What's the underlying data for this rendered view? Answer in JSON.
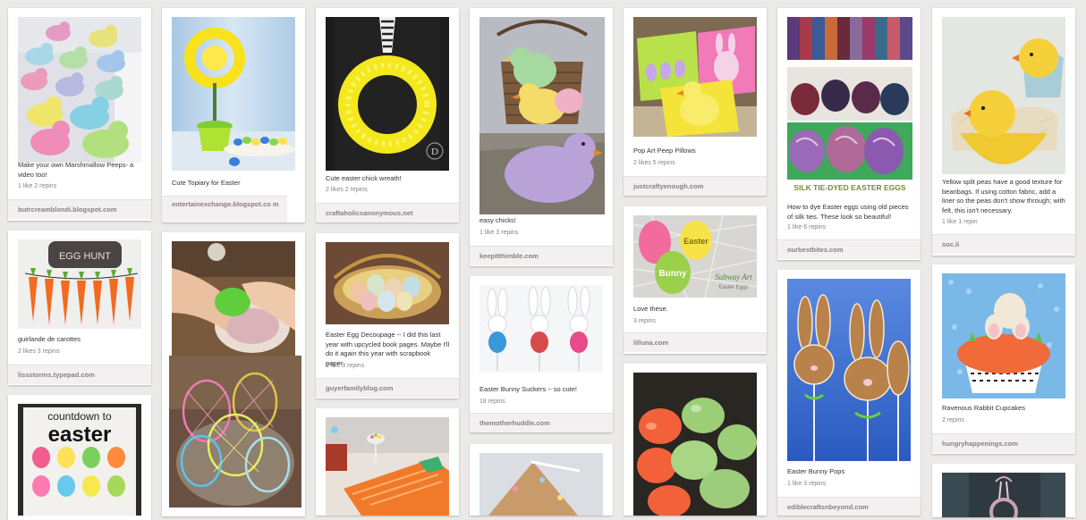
{
  "pins": {
    "peeps": {
      "description": "Make your own Marshmallow Peeps- a video too!",
      "stats": "1 like  2 repins",
      "source": "butrcreamblondi.blogspot.com"
    },
    "carrots": {
      "image_text": "EGG HUNT",
      "description": "guirlande de carottes",
      "stats": "2 likes  3 repins",
      "source": "lissstorms.typepad.com"
    },
    "countdown": {
      "image_text_line1": "countdown to",
      "image_text_line2": "easter"
    },
    "topiary": {
      "description": "Cute Topiary for Easter",
      "source": "entertainexchange.blogspot.co m"
    },
    "egg_dye": {},
    "string_eggs": {},
    "wreath": {
      "description": "Cute easter chick wreath!",
      "stats": "2 likes  2 repins",
      "source": "craftaholicsanonymous.net"
    },
    "decoupage": {
      "description": "Easter Egg Decoupage -- I did this last year with upcycled book pages. Maybe I'll do it again this year with scrapbook paper.",
      "stats": "1 like  3 repins",
      "source": "guyerfamilyblog.com"
    },
    "table_runner": {},
    "chicks": {
      "description": "easy chicks!",
      "stats": "1 like  3 repins",
      "source": "keepitthimble.com"
    },
    "suckers": {
      "description": "Easter Bunny Suckers ~ so cute!",
      "stats": "18 repins",
      "source": "themotherhuddle.com"
    },
    "gingerbread": {},
    "pillows": {
      "description": "Pop Art Peep Pillows",
      "stats": "2 likes  5 repins",
      "source": "justcraftyenough.com"
    },
    "subway": {
      "image_text_1": "Easter",
      "image_text_2": "Bunny",
      "image_caption": "Subway Art",
      "image_caption_sub": "Easter Eggs",
      "description": "Love these.",
      "stats": "3 repins",
      "source": "lilluna.com"
    },
    "glow_eggs": {},
    "silk_eggs": {
      "image_caption": "SILK TIE-DYED EASTER EGGS",
      "description": "How to dye Easter eggs using old pieces of silk ties. These look so beautiful!",
      "stats": "1 like  6 repins",
      "source": "ourbestbites.com"
    },
    "bunny_pops": {
      "description": "Easter Bunny Pops",
      "stats": "1 like  3 repins",
      "source": "ediblecraftsnbeyond.com"
    },
    "split_peas": {
      "description": "Yellow split peas have a good texture for beanbags. If using cotton fabric, add a liner so the peas don't show through; with felt, this isn't necessary.",
      "stats": "1 like  1 repin",
      "source": "soc.li"
    },
    "cupcakes": {
      "description": "Ravenous Rabbit Cupcakes",
      "stats": "2 repins",
      "source": "hungryhappenings.com"
    },
    "wreath_door": {}
  },
  "colors": {
    "background": "#ece9e9",
    "card": "#ffffff",
    "source_bar": "#f2f0f0",
    "muted_text": "#8c7e7e"
  }
}
